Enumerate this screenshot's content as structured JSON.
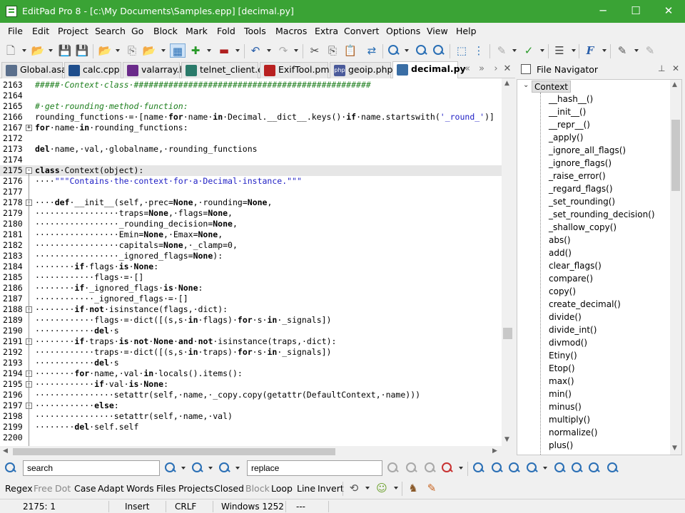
{
  "window": {
    "title": "EditPad Pro 8 - [c:\\My Documents\\Samples.epp] [decimal.py]",
    "minimize_glyph": "─",
    "maximize_glyph": "☐",
    "close_glyph": "✕"
  },
  "menu": [
    "File",
    "Edit",
    "Project",
    "Search",
    "Go",
    "Block",
    "Mark",
    "Fold",
    "Tools",
    "Macros",
    "Extra",
    "Convert",
    "Options",
    "View",
    "Help"
  ],
  "tabs": [
    {
      "label": "Global.asax",
      "icon": "asax-file-icon",
      "color": "#5a6f8c"
    },
    {
      "label": "calc.cpp",
      "icon": "cpp-file-icon",
      "color": "#1f4e8c"
    },
    {
      "label": "valarray.h",
      "icon": "header-file-icon",
      "color": "#6a2a8a"
    },
    {
      "label": "telnet_client.e",
      "icon": "eiffel-file-icon",
      "color": "#2a7a6a"
    },
    {
      "label": "ExifTool.pm",
      "icon": "perl-file-icon",
      "color": "#b82020"
    },
    {
      "label": "geoip.php",
      "icon": "php-file-icon",
      "color": "#4a5a9a",
      "badge": "php"
    },
    {
      "label": "decimal.py",
      "icon": "python-file-icon",
      "color": "#3a6ea5"
    }
  ],
  "navigator": {
    "title": "File Navigator",
    "root": "Context",
    "items": [
      "__hash__()",
      "__init__()",
      "__repr__()",
      "_apply()",
      "_ignore_all_flags()",
      "_ignore_flags()",
      "_raise_error()",
      "_regard_flags()",
      "_set_rounding()",
      "_set_rounding_decision()",
      "_shallow_copy()",
      "abs()",
      "add()",
      "clear_flags()",
      "compare()",
      "copy()",
      "create_decimal()",
      "divide()",
      "divide_int()",
      "divmod()",
      "Etiny()",
      "Etop()",
      "max()",
      "min()",
      "minus()",
      "multiply()",
      "normalize()",
      "plus()"
    ]
  },
  "editor": {
    "lines": [
      {
        "n": "2163",
        "fold": "",
        "segs": [
          {
            "t": "#####·Context·class·################################################",
            "c": "cmt"
          }
        ]
      },
      {
        "n": "2164",
        "fold": "",
        "segs": []
      },
      {
        "n": "2165",
        "fold": "",
        "segs": [
          {
            "t": "#·get·rounding·method·function:",
            "c": "cmt"
          }
        ]
      },
      {
        "n": "2166",
        "fold": "",
        "segs": [
          {
            "t": "rounding_functions·=·[name·"
          },
          {
            "t": "for",
            "c": "kw"
          },
          {
            "t": "·name·"
          },
          {
            "t": "in",
            "c": "kw"
          },
          {
            "t": "·Decimal.__dict__.keys()·"
          },
          {
            "t": "if",
            "c": "kw"
          },
          {
            "t": "·name.startswith("
          },
          {
            "t": "'_round_'",
            "c": "str"
          },
          {
            "t": ")]"
          }
        ]
      },
      {
        "n": "2167",
        "fold": "+",
        "segs": [
          {
            "t": "for",
            "c": "kw"
          },
          {
            "t": "·name·"
          },
          {
            "t": "in",
            "c": "kw"
          },
          {
            "t": "·rounding_functions:"
          }
        ]
      },
      {
        "n": "2172",
        "fold": "",
        "segs": []
      },
      {
        "n": "2173",
        "fold": "",
        "segs": [
          {
            "t": "del",
            "c": "kw"
          },
          {
            "t": "·name,·val,·globalname,·rounding_functions"
          }
        ]
      },
      {
        "n": "2174",
        "fold": "",
        "segs": []
      },
      {
        "n": "2175",
        "fold": "-",
        "cur": true,
        "segs": [
          {
            "t": "class",
            "c": "kw"
          },
          {
            "t": "·Context(object):"
          }
        ]
      },
      {
        "n": "2176",
        "fold": "",
        "segs": [
          {
            "t": "····"
          },
          {
            "t": "\"\"\"Contains·the·context·for·a·Decimal·instance.\"\"\"",
            "c": "str"
          }
        ]
      },
      {
        "n": "2177",
        "fold": "",
        "segs": []
      },
      {
        "n": "2178",
        "fold": "-",
        "segs": [
          {
            "t": "····"
          },
          {
            "t": "def",
            "c": "kw"
          },
          {
            "t": "·__init__(self,·prec="
          },
          {
            "t": "None",
            "c": "kw"
          },
          {
            "t": ",·rounding="
          },
          {
            "t": "None",
            "c": "kw"
          },
          {
            "t": ","
          }
        ]
      },
      {
        "n": "2179",
        "fold": "",
        "segs": [
          {
            "t": "·················traps="
          },
          {
            "t": "None",
            "c": "kw"
          },
          {
            "t": ",·flags="
          },
          {
            "t": "None",
            "c": "kw"
          },
          {
            "t": ","
          }
        ]
      },
      {
        "n": "2180",
        "fold": "",
        "segs": [
          {
            "t": "·················_rounding_decision="
          },
          {
            "t": "None",
            "c": "kw"
          },
          {
            "t": ","
          }
        ]
      },
      {
        "n": "2181",
        "fold": "",
        "segs": [
          {
            "t": "·················Emin="
          },
          {
            "t": "None",
            "c": "kw"
          },
          {
            "t": ",·Emax="
          },
          {
            "t": "None",
            "c": "kw"
          },
          {
            "t": ","
          }
        ]
      },
      {
        "n": "2182",
        "fold": "",
        "segs": [
          {
            "t": "·················capitals="
          },
          {
            "t": "None",
            "c": "kw"
          },
          {
            "t": ",·_clamp=0,"
          }
        ]
      },
      {
        "n": "2183",
        "fold": "",
        "segs": [
          {
            "t": "·················_ignored_flags="
          },
          {
            "t": "None",
            "c": "kw"
          },
          {
            "t": "):"
          }
        ]
      },
      {
        "n": "2184",
        "fold": "",
        "segs": [
          {
            "t": "········"
          },
          {
            "t": "if",
            "c": "kw"
          },
          {
            "t": "·flags·"
          },
          {
            "t": "is",
            "c": "kw"
          },
          {
            "t": "·"
          },
          {
            "t": "None",
            "c": "kw"
          },
          {
            "t": ":"
          }
        ]
      },
      {
        "n": "2185",
        "fold": "",
        "segs": [
          {
            "t": "············flags·=·[]"
          }
        ]
      },
      {
        "n": "2186",
        "fold": "",
        "segs": [
          {
            "t": "········"
          },
          {
            "t": "if",
            "c": "kw"
          },
          {
            "t": "·_ignored_flags·"
          },
          {
            "t": "is",
            "c": "kw"
          },
          {
            "t": "·"
          },
          {
            "t": "None",
            "c": "kw"
          },
          {
            "t": ":"
          }
        ]
      },
      {
        "n": "2187",
        "fold": "",
        "segs": [
          {
            "t": "············_ignored_flags·=·[]"
          }
        ]
      },
      {
        "n": "2188",
        "fold": "-",
        "segs": [
          {
            "t": "········"
          },
          {
            "t": "if",
            "c": "kw"
          },
          {
            "t": "·"
          },
          {
            "t": "not",
            "c": "kw"
          },
          {
            "t": "·isinstance(flags,·dict):"
          }
        ]
      },
      {
        "n": "2189",
        "fold": "",
        "segs": [
          {
            "t": "············flags·=·dict([(s,s·"
          },
          {
            "t": "in",
            "c": "kw"
          },
          {
            "t": "·flags)·"
          },
          {
            "t": "for",
            "c": "kw"
          },
          {
            "t": "·s·"
          },
          {
            "t": "in",
            "c": "kw"
          },
          {
            "t": "·_signals])"
          }
        ]
      },
      {
        "n": "2190",
        "fold": "",
        "segs": [
          {
            "t": "············"
          },
          {
            "t": "del",
            "c": "kw"
          },
          {
            "t": "·s"
          }
        ]
      },
      {
        "n": "2191",
        "fold": "-",
        "segs": [
          {
            "t": "········"
          },
          {
            "t": "if",
            "c": "kw"
          },
          {
            "t": "·traps·"
          },
          {
            "t": "is",
            "c": "kw"
          },
          {
            "t": "·"
          },
          {
            "t": "not",
            "c": "kw"
          },
          {
            "t": "·"
          },
          {
            "t": "None",
            "c": "kw"
          },
          {
            "t": "·"
          },
          {
            "t": "and",
            "c": "kw"
          },
          {
            "t": "·"
          },
          {
            "t": "not",
            "c": "kw"
          },
          {
            "t": "·isinstance(traps,·dict):"
          }
        ]
      },
      {
        "n": "2192",
        "fold": "",
        "segs": [
          {
            "t": "············traps·=·dict([(s,s·"
          },
          {
            "t": "in",
            "c": "kw"
          },
          {
            "t": "·traps)·"
          },
          {
            "t": "for",
            "c": "kw"
          },
          {
            "t": "·s·"
          },
          {
            "t": "in",
            "c": "kw"
          },
          {
            "t": "·_signals])"
          }
        ]
      },
      {
        "n": "2193",
        "fold": "",
        "segs": [
          {
            "t": "············"
          },
          {
            "t": "del",
            "c": "kw"
          },
          {
            "t": "·s"
          }
        ]
      },
      {
        "n": "2194",
        "fold": "-",
        "segs": [
          {
            "t": "········"
          },
          {
            "t": "for",
            "c": "kw"
          },
          {
            "t": "·name,·val·"
          },
          {
            "t": "in",
            "c": "kw"
          },
          {
            "t": "·locals().items():"
          }
        ]
      },
      {
        "n": "2195",
        "fold": "-",
        "segs": [
          {
            "t": "············"
          },
          {
            "t": "if",
            "c": "kw"
          },
          {
            "t": "·val·"
          },
          {
            "t": "is",
            "c": "kw"
          },
          {
            "t": "·"
          },
          {
            "t": "None",
            "c": "kw"
          },
          {
            "t": ":"
          }
        ]
      },
      {
        "n": "2196",
        "fold": "",
        "segs": [
          {
            "t": "················setattr(self,·name,·_copy.copy(getattr(DefaultContext,·name)))"
          }
        ]
      },
      {
        "n": "2197",
        "fold": "-",
        "segs": [
          {
            "t": "············"
          },
          {
            "t": "else",
            "c": "kw"
          },
          {
            "t": ":"
          }
        ]
      },
      {
        "n": "2198",
        "fold": "",
        "segs": [
          {
            "t": "················setattr(self,·name,·val)"
          }
        ]
      },
      {
        "n": "2199",
        "fold": "",
        "segs": [
          {
            "t": "········"
          },
          {
            "t": "del",
            "c": "kw"
          },
          {
            "t": "·self.self"
          }
        ]
      },
      {
        "n": "2200",
        "fold": "",
        "segs": []
      }
    ]
  },
  "search": {
    "search_value": "search",
    "replace_value": "replace"
  },
  "options": {
    "items": [
      {
        "label": "Regex",
        "enabled": true
      },
      {
        "label": "Free",
        "enabled": false
      },
      {
        "label": "Dot",
        "enabled": false
      },
      {
        "label": "Case",
        "enabled": true
      },
      {
        "label": "Adapt",
        "enabled": true
      },
      {
        "label": "Words",
        "enabled": true
      },
      {
        "label": "Files",
        "enabled": true
      },
      {
        "label": "Projects",
        "enabled": true
      },
      {
        "label": "Closed",
        "enabled": true
      },
      {
        "label": "Block",
        "enabled": false
      },
      {
        "label": "Loop",
        "enabled": true
      },
      {
        "label": "Line",
        "enabled": true
      },
      {
        "label": "Invert",
        "enabled": true
      }
    ]
  },
  "status": {
    "position": "2175: 1",
    "mode": "Insert",
    "line_break": "CRLF",
    "encoding": "Windows 1252",
    "extra": "---"
  },
  "colors": {
    "titlebar": "#3aa335",
    "keyword": "#000000",
    "string": "#1d1dc4",
    "comment": "#208020"
  }
}
